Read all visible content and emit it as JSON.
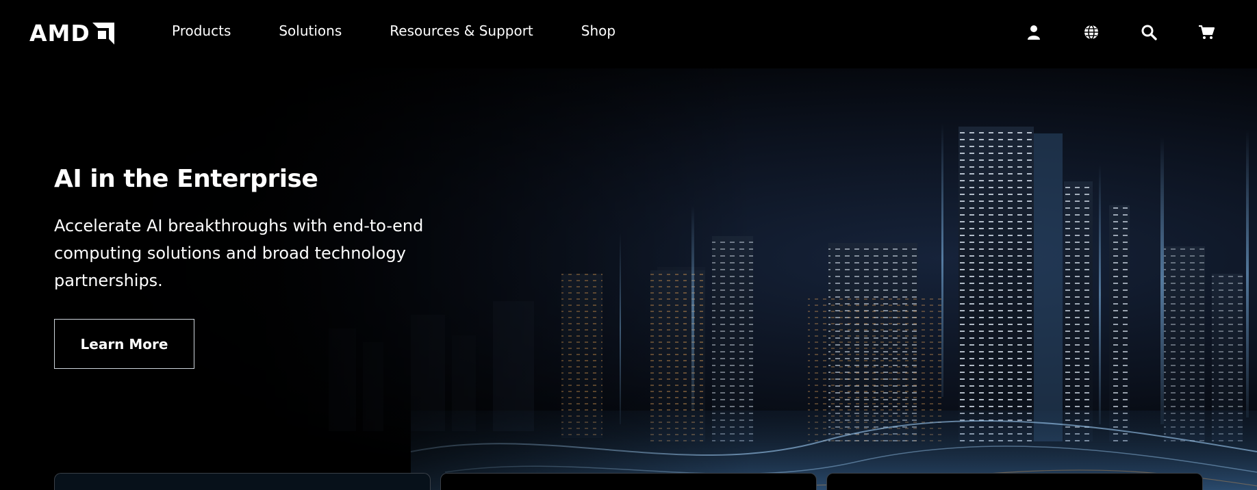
{
  "header": {
    "logo_text": "AMD",
    "nav": [
      {
        "label": "Products"
      },
      {
        "label": "Solutions"
      },
      {
        "label": "Resources & Support"
      },
      {
        "label": "Shop"
      }
    ],
    "utilities": [
      {
        "icon": "user-icon"
      },
      {
        "icon": "globe-icon"
      },
      {
        "icon": "search-icon"
      },
      {
        "icon": "cart-icon"
      }
    ]
  },
  "hero": {
    "title": "AI in the Enterprise",
    "description": "Accelerate AI breakthroughs with end-to-end computing solutions and broad technology partnerships.",
    "cta_label": "Learn More"
  },
  "colors": {
    "background": "#000000",
    "text": "#ffffff",
    "button_border": "#cfd6dd",
    "city_glow": "#7fb6e6",
    "city_warm": "#d79a55"
  }
}
